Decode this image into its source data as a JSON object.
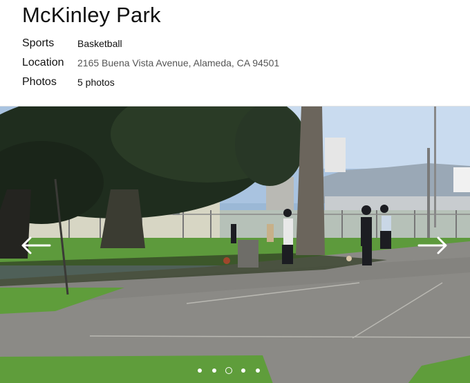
{
  "park": {
    "name": "McKinley Park",
    "details": {
      "sports_label": "Sports",
      "sports_value": "Basketball",
      "location_label": "Location",
      "location_value": "2165 Buena Vista Avenue, Alameda, CA 94501",
      "photos_label": "Photos",
      "photos_value": "5 photos"
    }
  },
  "carousel": {
    "current_index": 3,
    "total": 5,
    "prev_icon": "arrow-left-icon",
    "next_icon": "arrow-right-icon"
  },
  "colors": {
    "text": "#111111",
    "link": "#555555",
    "indicator": "#ffffff"
  }
}
